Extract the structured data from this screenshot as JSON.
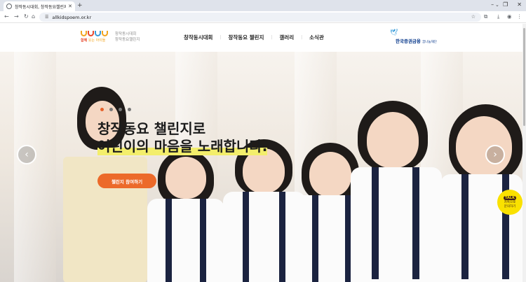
{
  "browser": {
    "tab_title": "창작동시대회, 창작동요챌린지",
    "url": "allkidspoem.or.kr",
    "icons": [
      "back-icon",
      "forward-icon",
      "reload-icon",
      "home-icon",
      "tune-icon",
      "star-icon",
      "extensions-icon",
      "download-icon",
      "profile-icon",
      "menu-icon"
    ]
  },
  "site": {
    "logo_brand_red": "함께",
    "logo_brand_orange": "웃는 아이들",
    "sub_brand_line1": "창작동시대회",
    "sub_brand_line2": "창작동요챌린지",
    "nav": [
      "창작동시대회",
      "창작동요 챌린지",
      "갤러리",
      "소식관"
    ],
    "partner_name": "한국증권금융",
    "partner_sub": "꿈나눔재단"
  },
  "hero": {
    "headline_line1": "창작동요 챌린지로",
    "headline_line2": "어린이의 마음을 노래합니다.",
    "cta_label": "챌린지 참여하기",
    "slide_count": 4,
    "active_slide": 1,
    "prev_symbol": "‹",
    "next_symbol": "›"
  },
  "kakao": {
    "badge": "TALK",
    "label_line1": "카톡으로",
    "label_line2": "문의하기"
  },
  "colors": {
    "accent_orange": "#ec6a2a",
    "highlight_yellow": "#f3ee6b",
    "kakao_yellow": "#fae100"
  }
}
